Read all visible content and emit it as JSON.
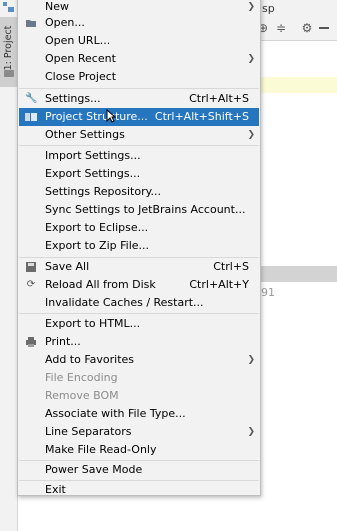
{
  "background": {
    "left_tab_label": "1: Project",
    "toolbar_text": "sp",
    "side_number": "91"
  },
  "menu": {
    "items": [
      {
        "label": "New",
        "arrow": true,
        "icon": null
      },
      {
        "label": "Open...",
        "icon": "folder-open-icon"
      },
      {
        "label": "Open URL..."
      },
      {
        "label": "Open Recent",
        "arrow": true
      },
      {
        "label": "Close Project"
      },
      {
        "label": "Settings...",
        "shortcut": "Ctrl+Alt+S",
        "icon": "wrench-icon"
      },
      {
        "label": "Project Structure...",
        "shortcut": "Ctrl+Alt+Shift+S",
        "icon": "project-structure-icon",
        "selected": true
      },
      {
        "label": "Other Settings",
        "arrow": true
      },
      {
        "label": "Import Settings..."
      },
      {
        "label": "Export Settings..."
      },
      {
        "label": "Settings Repository..."
      },
      {
        "label": "Sync Settings to JetBrains Account..."
      },
      {
        "label": "Export to Eclipse..."
      },
      {
        "label": "Export to Zip File..."
      },
      {
        "label": "Save All",
        "shortcut": "Ctrl+S",
        "icon": "save-icon"
      },
      {
        "label": "Reload All from Disk",
        "shortcut": "Ctrl+Alt+Y",
        "icon": "reload-icon"
      },
      {
        "label": "Invalidate Caches / Restart..."
      },
      {
        "label": "Export to HTML..."
      },
      {
        "label": "Print...",
        "icon": "print-icon"
      },
      {
        "label": "Add to Favorites",
        "arrow": true
      },
      {
        "label": "File Encoding",
        "disabled": true
      },
      {
        "label": "Remove BOM",
        "disabled": true
      },
      {
        "label": "Associate with File Type..."
      },
      {
        "label": "Line Separators",
        "arrow": true
      },
      {
        "label": "Make File Read-Only"
      },
      {
        "label": "Power Save Mode"
      },
      {
        "label": "Exit"
      }
    ]
  },
  "colors": {
    "selection": "#2675bf",
    "menu_bg": "#f2f2f2",
    "disabled_text": "#8c8c8c"
  }
}
